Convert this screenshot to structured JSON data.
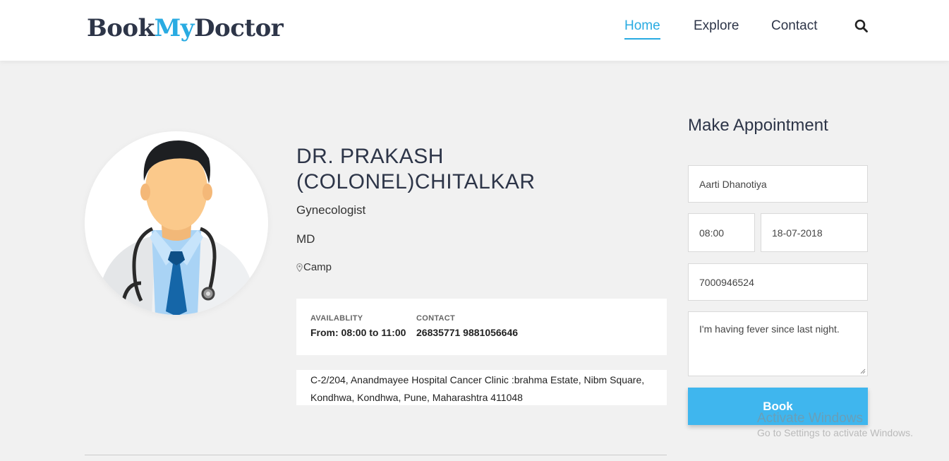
{
  "header": {
    "logo_part1": "Book",
    "logo_part2": "My",
    "logo_part3": "Doctor",
    "nav": [
      {
        "label": "Home",
        "active": true
      },
      {
        "label": "Explore"
      },
      {
        "label": "Contact"
      }
    ],
    "search_icon": "search-icon"
  },
  "doctor": {
    "name": "DR. PRAKASH (COLONEL)CHITALKAR",
    "specialty": "Gynecologist",
    "degree": "MD",
    "location": "Camp",
    "availability_label": "AVAILABLITY",
    "availability_value": "From: 08:00 to 11:00",
    "contact_label": "CONTACT",
    "contact_value": "26835771 9881056646",
    "address_line1": "C-2/204, Anandmayee Hospital Cancer Clinic :brahma Estate, Nibm Square,",
    "address_line2": "Kondhwa, Kondhwa, Pune, Maharashtra 411048"
  },
  "appointment": {
    "title": "Make Appointment",
    "name_value": "Aarti Dhanotiya",
    "time_value": "08:00",
    "date_value": "18-07-2018",
    "phone_value": "7000946524",
    "message_value": "I'm having fever since last night.",
    "book_label": "Book"
  },
  "watermark": {
    "line1": "Activate Windows",
    "line2": "Go to Settings to activate Windows."
  },
  "colors": {
    "accent": "#29abe2",
    "button": "#3fb6ee",
    "dark_text": "#2d3548",
    "background": "#f1f1f1"
  }
}
